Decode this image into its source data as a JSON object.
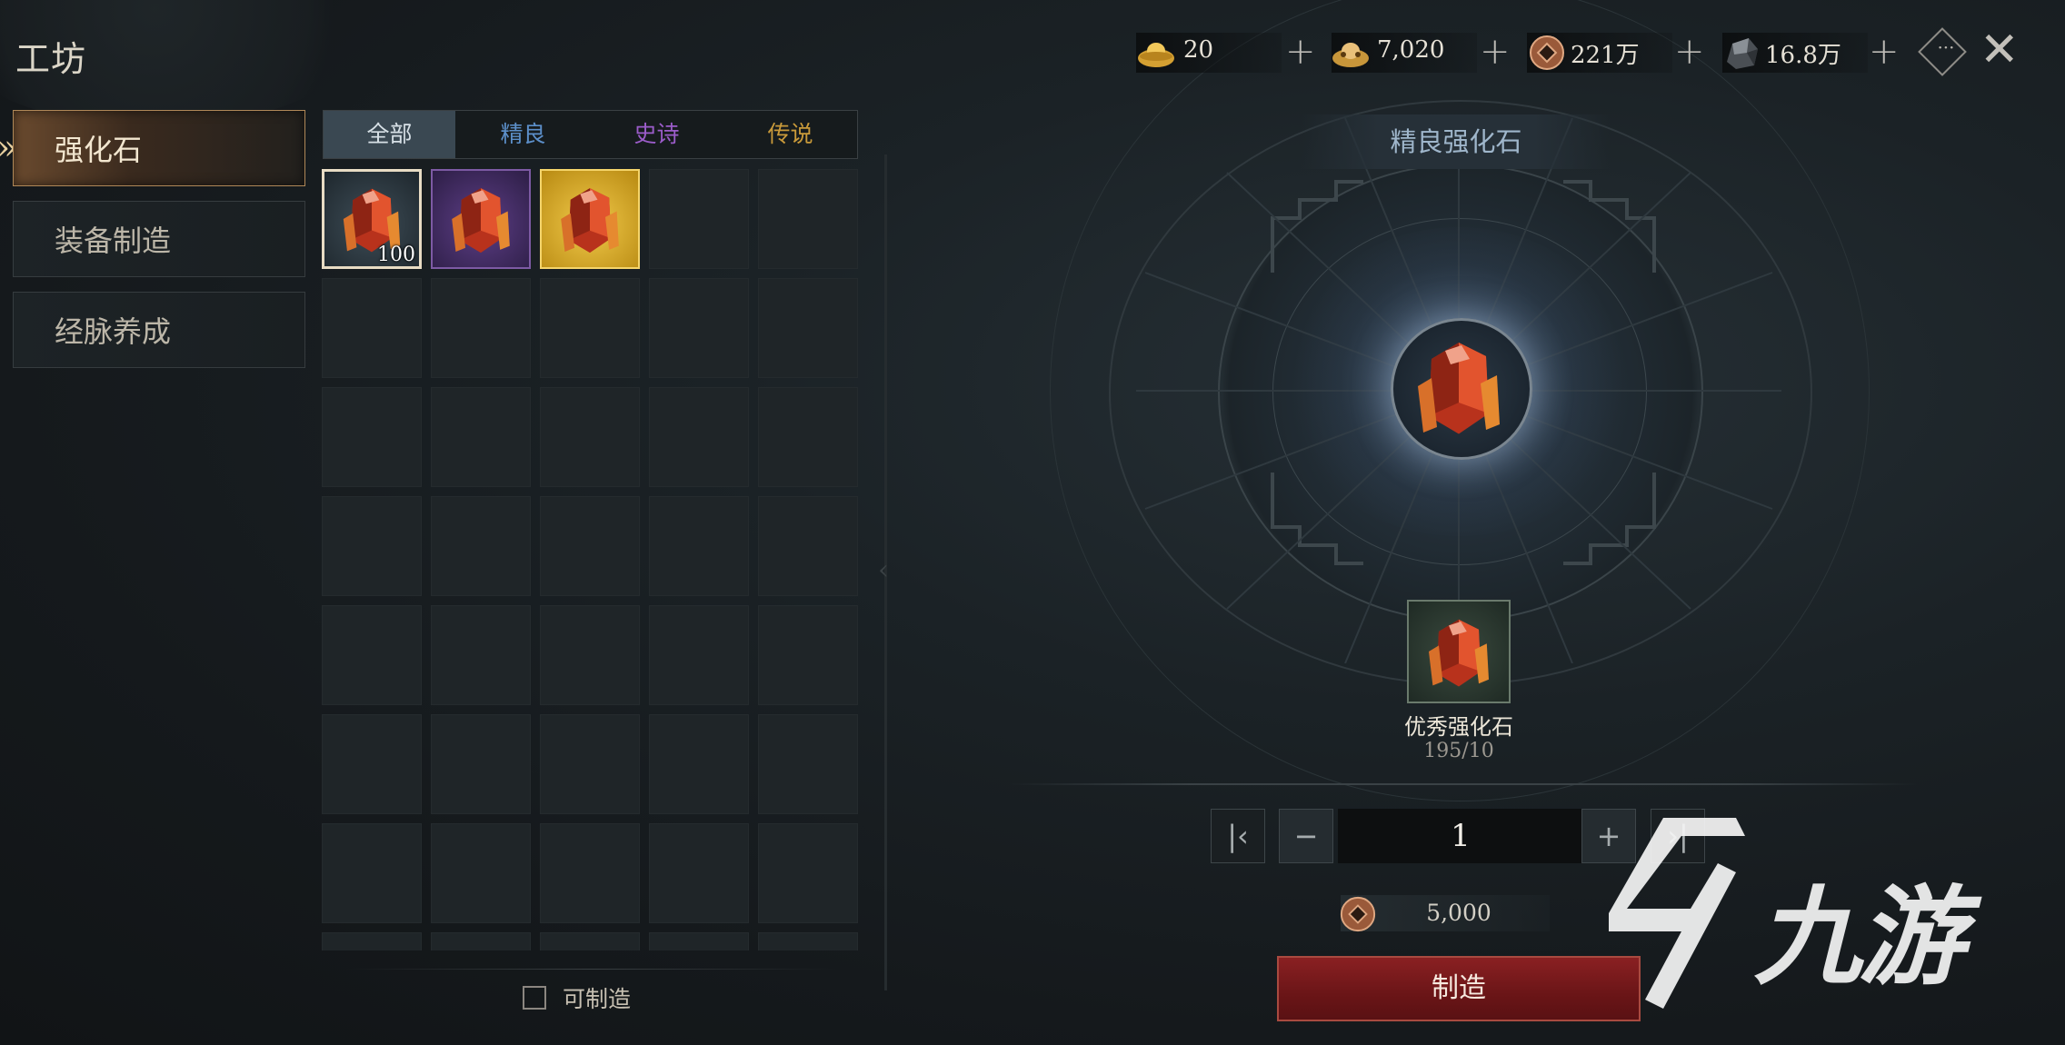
{
  "header": {
    "title": "工坊"
  },
  "currencies": [
    {
      "icon": "gold-ingot-icon",
      "value": "20"
    },
    {
      "icon": "silver-ingot-icon",
      "value": "7,020"
    },
    {
      "icon": "copper-coin-icon",
      "value": "221万"
    },
    {
      "icon": "ore-icon",
      "value": "16.8万"
    }
  ],
  "sidebar": {
    "items": [
      {
        "label": "强化石",
        "active": true
      },
      {
        "label": "装备制造",
        "active": false
      },
      {
        "label": "经脉养成",
        "active": false
      }
    ]
  },
  "tabs": [
    {
      "label": "全部",
      "color": "#d7e0e6",
      "active": true
    },
    {
      "label": "精良",
      "color": "#5c8fc9",
      "active": false
    },
    {
      "label": "史诗",
      "color": "#9b5cc9",
      "active": false
    },
    {
      "label": "传说",
      "color": "#c99a3a",
      "active": false
    }
  ],
  "items": [
    {
      "name": "good-enhance-stone",
      "rarity": "good",
      "count": "100"
    },
    {
      "name": "epic-enhance-stone",
      "rarity": "epic",
      "count": ""
    },
    {
      "name": "legendary-enhance-stone",
      "rarity": "legendary",
      "count": ""
    }
  ],
  "filter": {
    "craftable_label": "可制造",
    "checked": false
  },
  "detail": {
    "title": "精良强化石",
    "material": {
      "name": "优秀强化石",
      "count": "195/10"
    },
    "quantity": "1",
    "cost": "5,000",
    "craft_label": "制造"
  },
  "watermark": {
    "text": "九游"
  },
  "colors": {
    "craft_button": "#7a1a1c",
    "active_tab": "#3a4852"
  }
}
